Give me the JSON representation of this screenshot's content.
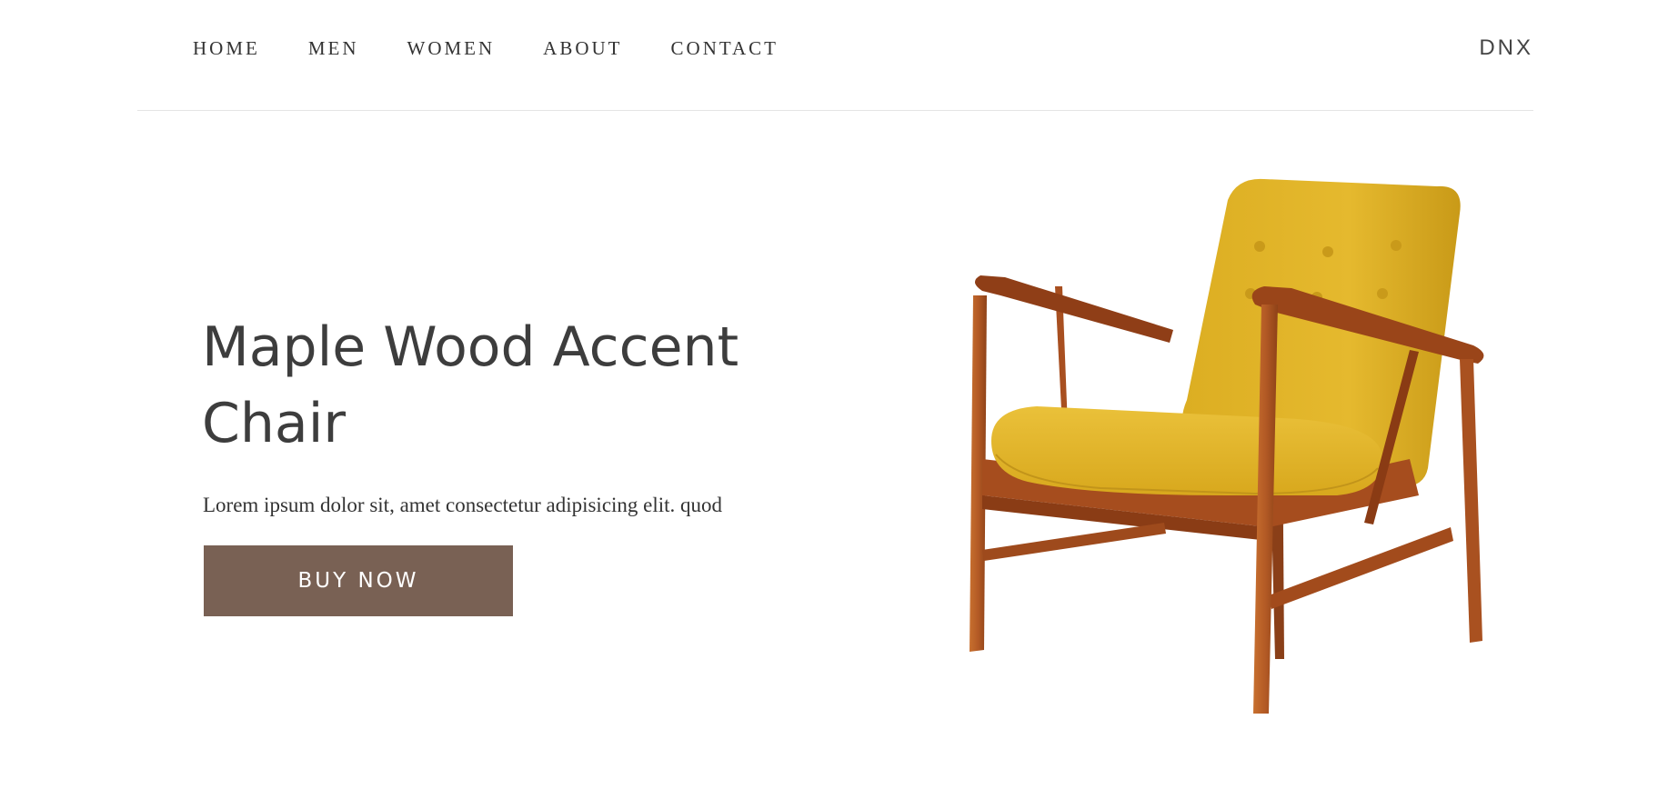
{
  "header": {
    "nav": [
      {
        "label": "HOME"
      },
      {
        "label": "MEN"
      },
      {
        "label": "WOMEN"
      },
      {
        "label": "ABOUT"
      },
      {
        "label": "CONTACT"
      }
    ],
    "brand": "DNX"
  },
  "hero": {
    "title": "Maple Wood Accent Chair",
    "description": "Lorem ipsum dolor sit, amet consectetur adipisicing elit. quod",
    "button_label": "BUY NOW",
    "button_color": "#796154",
    "image": {
      "icon": "armchair-illustration",
      "seat_color": "#e2b526",
      "wood_color": "#b35a25"
    }
  }
}
